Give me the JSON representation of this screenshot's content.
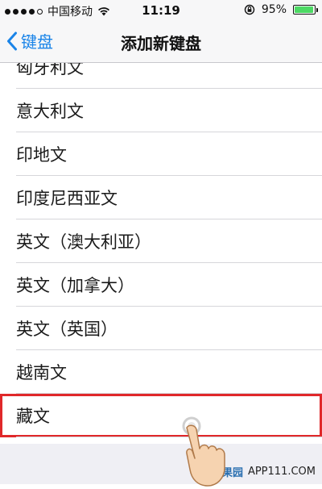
{
  "status_bar": {
    "carrier": "中国移动",
    "time": "11:19",
    "battery_percent": "95%",
    "battery_level": 0.95,
    "icons": [
      "signal-dots-icon",
      "wifi-icon",
      "rotation-lock-icon",
      "battery-icon"
    ]
  },
  "nav": {
    "back_label": "键盘",
    "title": "添加新键盘"
  },
  "list": {
    "items": [
      "匈牙利文",
      "意大利文",
      "印地文",
      "印度尼西亚文",
      "英文（澳大利亚）",
      "英文（加拿大）",
      "英文（英国）",
      "越南文",
      "藏文"
    ],
    "highlighted_index": 8
  },
  "watermark": {
    "brand": "苹果园",
    "site": "APP111.COM"
  },
  "colors": {
    "accent": "#1a84e8",
    "highlight_border": "#e0282a",
    "battery": "#4cd964"
  }
}
